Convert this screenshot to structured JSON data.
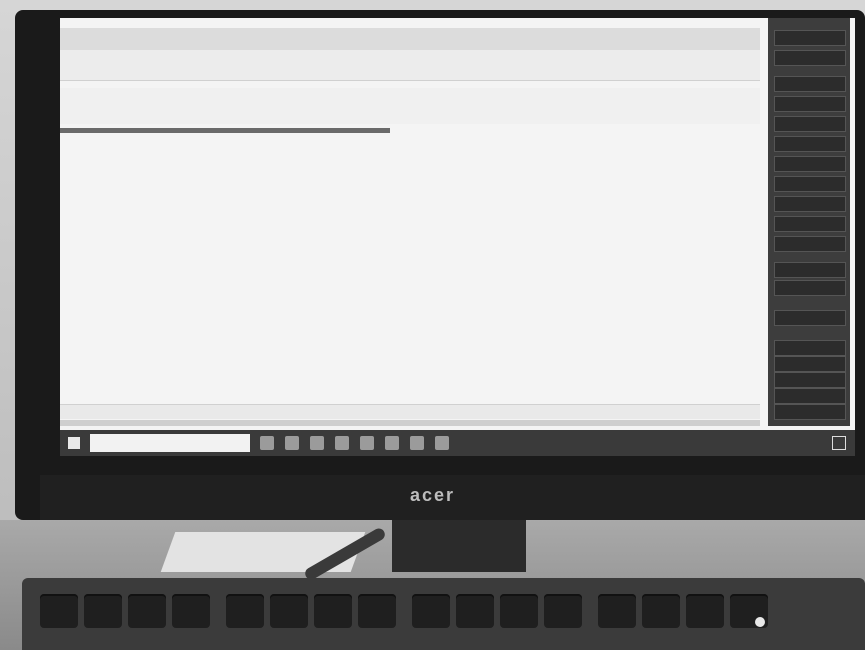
{
  "monitor": {
    "brand": "acer"
  },
  "app": {
    "header_tabs": [
      "",
      ""
    ],
    "title": "",
    "left_list": [
      "",
      "",
      "",
      "",
      "",
      "",
      "",
      ""
    ],
    "center_values": [
      "",
      ""
    ],
    "mid_values": [
      "",
      "",
      "",
      "",
      "",
      ""
    ],
    "right_values": [
      "",
      "",
      "",
      "",
      "",
      ""
    ],
    "bottom_left": "",
    "bottom_center": "",
    "bottom_right": ""
  },
  "right_panel": {
    "buttons": [
      "",
      "",
      "",
      "",
      "",
      "",
      "",
      "",
      "",
      "",
      "",
      "",
      "",
      "",
      "",
      "",
      "",
      "",
      "",
      ""
    ]
  },
  "taskbar": {
    "search_placeholder": "",
    "tray_text": "",
    "time": "",
    "date": ""
  },
  "icons": [
    "windows-start-icon",
    "search-icon",
    "taskview-icon",
    "file-explorer-icon",
    "store-icon",
    "mail-icon",
    "browser-icon",
    "app-icon",
    "notification-icon"
  ]
}
